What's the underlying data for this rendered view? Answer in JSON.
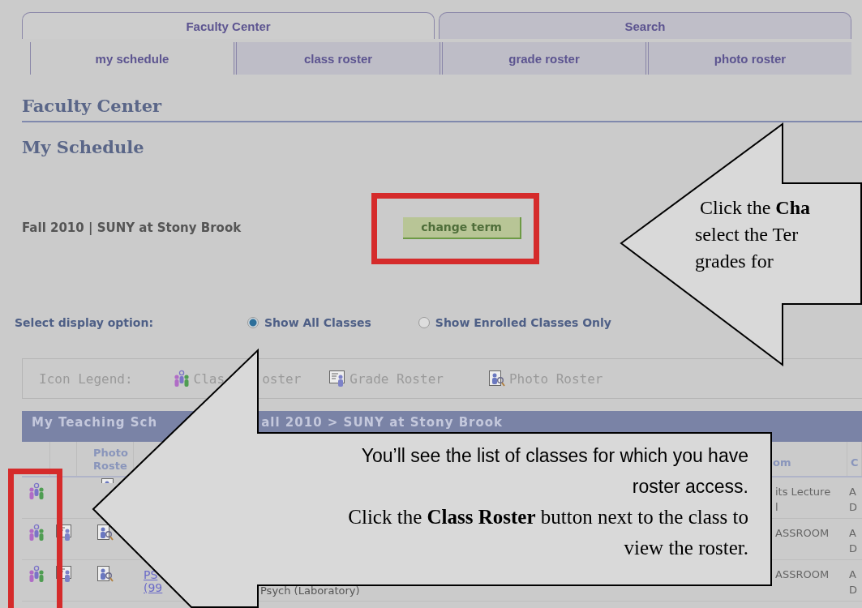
{
  "tabs": [
    {
      "label": "Faculty Center",
      "selected": true
    },
    {
      "label": "Search",
      "selected": false
    }
  ],
  "subtabs": [
    {
      "label": "my schedule",
      "selected": true
    },
    {
      "label": "class roster",
      "selected": false
    },
    {
      "label": "grade roster",
      "selected": false
    },
    {
      "label": "photo roster",
      "selected": false
    }
  ],
  "page_title": "Faculty Center",
  "section_title": "My Schedule",
  "term": {
    "label": "Fall 2010 | SUNY at Stony Brook",
    "button": "change term"
  },
  "display_option": {
    "label": "Select display option:",
    "options": [
      {
        "label": "Show All Classes",
        "selected": true
      },
      {
        "label": "Show Enrolled Classes Only",
        "selected": false
      }
    ]
  },
  "icon_legend": {
    "label": "Icon Legend:",
    "items": [
      {
        "kind": "class",
        "parts": [
          "Clas",
          "oster"
        ]
      },
      {
        "kind": "grade",
        "parts": [
          "Grade Roster"
        ]
      },
      {
        "kind": "photo",
        "parts": [
          "Photo Roster"
        ]
      }
    ]
  },
  "schedule": {
    "title_parts": [
      "My Teaching Sch",
      "all 2010 > SUNY at Stony Brook"
    ],
    "column_headers": {
      "photo_roster": "Photo\nRoste",
      "room": "om",
      "column_7": "C"
    },
    "rows": [
      {
        "class_roster": true,
        "grade_roster": false,
        "photo_roster": true,
        "room": "its Lecture\nl",
        "column_7": "A\nD"
      },
      {
        "class_roster": true,
        "grade_roster": true,
        "photo_roster": true,
        "room": "ASSROOM",
        "column_7": "A\nD"
      },
      {
        "class_roster": true,
        "grade_roster": true,
        "photo_roster": true,
        "class": "PS\n(99",
        "description": "Psych (Laboratory)",
        "room": "ASSROOM",
        "column_7": "A\nD"
      }
    ]
  },
  "callouts": [
    {
      "kind": "term",
      "paragraphs": [
        " Click the **Cha**\nselect the Ter\ngrades for"
      ]
    },
    {
      "kind": "roster",
      "paragraphs": [
        "You’ll see the list of classes for which you have\nroster access.",
        "Click the **Class Roster** button next to the class to\nview the roster."
      ]
    }
  ]
}
